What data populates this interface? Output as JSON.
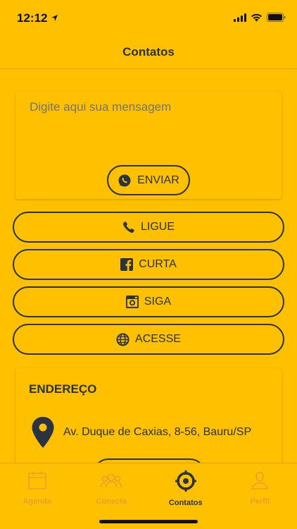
{
  "status_bar": {
    "time": "12:12"
  },
  "header": {
    "title": "Contatos"
  },
  "message": {
    "placeholder": "Digite aqui sua mensagem",
    "send_label": "ENVIAR",
    "send_icon": "whatsapp-icon"
  },
  "actions": [
    {
      "label": "LIGUE",
      "icon": "phone-icon"
    },
    {
      "label": "CURTA",
      "icon": "facebook-icon"
    },
    {
      "label": "SIGA",
      "icon": "instagram-icon"
    },
    {
      "label": "ACESSE",
      "icon": "globe-icon"
    }
  ],
  "address": {
    "title": "ENDEREÇO",
    "text": "Av. Duque de Caxias, 8-56, Bauru/SP",
    "icon": "map-pin-icon"
  },
  "tabs": [
    {
      "label": "Agenda",
      "icon": "calendar-icon",
      "active": false
    },
    {
      "label": "Conecta",
      "icon": "people-icon",
      "active": false
    },
    {
      "label": "Contatos",
      "icon": "compass-icon",
      "active": true
    },
    {
      "label": "Perfil",
      "icon": "person-icon",
      "active": false
    }
  ],
  "colors": {
    "background": "#FFC000",
    "primary": "#2B3342",
    "inactive_tab": "#E8A22A",
    "placeholder": "#C9A560"
  }
}
